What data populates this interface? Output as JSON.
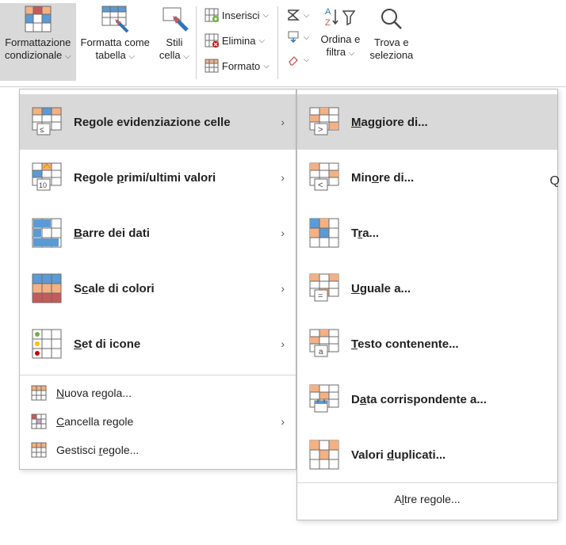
{
  "ribbon": {
    "cond_format": {
      "line1": "Formattazione",
      "line2": "condizionale"
    },
    "format_table": {
      "line1": "Formatta come",
      "line2": "tabella"
    },
    "cell_styles": {
      "line1": "Stili",
      "line2": "cella"
    },
    "cells": {
      "insert": "Inserisci",
      "delete": "Elimina",
      "format": "Formato"
    },
    "sort_filter": {
      "line1": "Ordina e",
      "line2": "filtra"
    },
    "find": {
      "line1": "Trova e",
      "line2": "seleziona"
    }
  },
  "menu1": {
    "highlight": "Regole evidenziazione celle",
    "topbottom_pre": "Regole ",
    "topbottom_u": "p",
    "topbottom_post": "rimi/ultimi valori",
    "databars_u": "B",
    "databars_post": "arre dei dati",
    "colorscales_pre": "S",
    "colorscales_u": "c",
    "colorscales_post": "ale di colori",
    "iconsets_u": "S",
    "iconsets_post": "et di icone",
    "newrule_u": "N",
    "newrule_post": "uova regola...",
    "clear_u": "C",
    "clear_post": "ancella regole",
    "manage_pre": "Gestisci ",
    "manage_u": "r",
    "manage_post": "egole..."
  },
  "menu2": {
    "greater_u": "M",
    "greater_post": "aggiore di...",
    "less_pre": "Min",
    "less_u": "o",
    "less_post": "re di...",
    "between_pre": "T",
    "between_u": "r",
    "between_post": "a...",
    "equal_u": "U",
    "equal_post": "guale a...",
    "text_u": "T",
    "text_post": "esto contenente...",
    "date_pre": "D",
    "date_u": "a",
    "date_post": "ta corrispondente a...",
    "dup_pre": "Valori ",
    "dup_u": "d",
    "dup_post": "uplicati...",
    "more_pre": "A",
    "more_u": "l",
    "more_post": "tre regole..."
  },
  "chev": "⌵",
  "arrow": "›"
}
